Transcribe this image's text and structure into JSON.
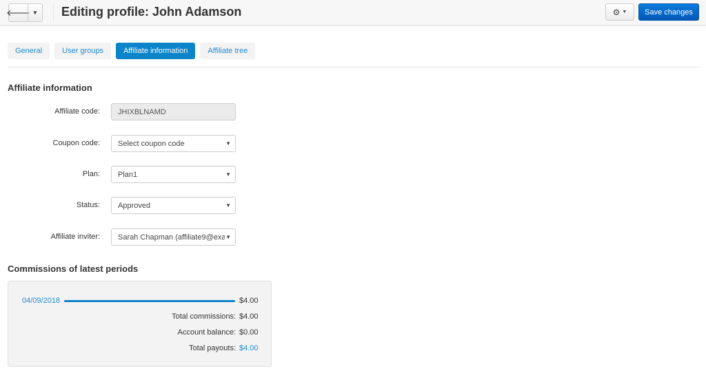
{
  "header": {
    "title": "Editing profile: John Adamson",
    "back_icon": "arrow-left-icon",
    "dropdown_icon": "caret-down-icon",
    "gear_icon": "gear-icon",
    "save_label": "Save changes"
  },
  "tabs": [
    {
      "label": "General",
      "active": false
    },
    {
      "label": "User groups",
      "active": false
    },
    {
      "label": "Affiliate information",
      "active": true
    },
    {
      "label": "Affiliate tree",
      "active": false
    }
  ],
  "affiliate_section": {
    "heading": "Affiliate information",
    "fields": [
      {
        "label": "Affiliate code:",
        "value": "JHIXBLNAMD",
        "type": "readonly"
      },
      {
        "label": "Coupon code:",
        "value": "Select coupon code",
        "type": "select"
      },
      {
        "label": "Plan:",
        "value": "Plan1",
        "type": "select"
      },
      {
        "label": "Status:",
        "value": "Approved",
        "type": "select"
      },
      {
        "label": "Affiliate inviter:",
        "value": "Sarah Chapman (affiliate9@exa",
        "type": "select"
      }
    ]
  },
  "commissions": {
    "heading": "Commissions of latest periods",
    "periods": [
      {
        "date": "04/09/2018",
        "amount": "$4.00",
        "fraction": 1.0
      }
    ],
    "totals": [
      {
        "label": "Total commissions:",
        "value": "$4.00",
        "link": false
      },
      {
        "label": "Account balance:",
        "value": "$0.00",
        "link": false
      },
      {
        "label": "Total payouts:",
        "value": "$4.00",
        "link": true
      }
    ]
  },
  "colors": {
    "accent": "#0b84c9",
    "link": "#1f8bd1",
    "save": "#0a6fd3"
  }
}
